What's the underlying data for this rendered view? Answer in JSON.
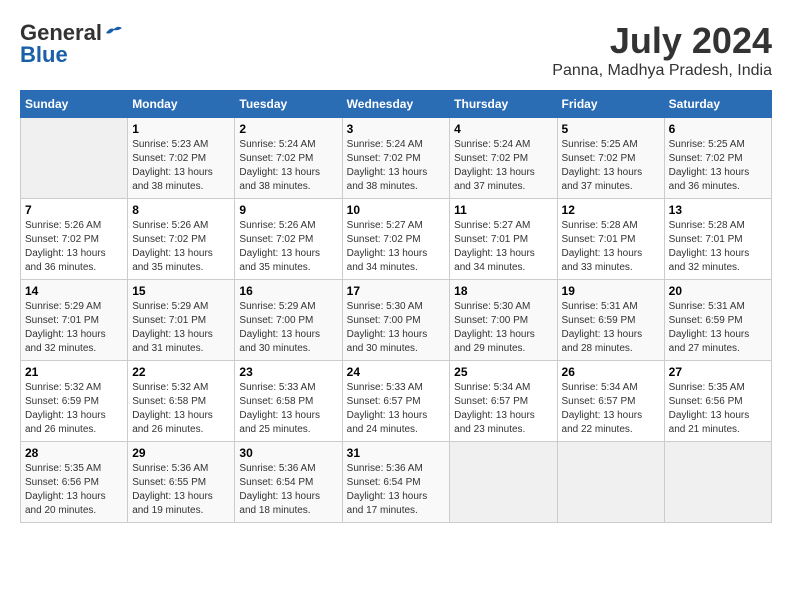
{
  "logo": {
    "general": "General",
    "blue": "Blue"
  },
  "title": "July 2024",
  "subtitle": "Panna, Madhya Pradesh, India",
  "days_of_week": [
    "Sunday",
    "Monday",
    "Tuesday",
    "Wednesday",
    "Thursday",
    "Friday",
    "Saturday"
  ],
  "weeks": [
    [
      {
        "day": "",
        "empty": true
      },
      {
        "day": "1",
        "sunrise": "Sunrise: 5:23 AM",
        "sunset": "Sunset: 7:02 PM",
        "daylight": "Daylight: 13 hours and 38 minutes."
      },
      {
        "day": "2",
        "sunrise": "Sunrise: 5:24 AM",
        "sunset": "Sunset: 7:02 PM",
        "daylight": "Daylight: 13 hours and 38 minutes."
      },
      {
        "day": "3",
        "sunrise": "Sunrise: 5:24 AM",
        "sunset": "Sunset: 7:02 PM",
        "daylight": "Daylight: 13 hours and 38 minutes."
      },
      {
        "day": "4",
        "sunrise": "Sunrise: 5:24 AM",
        "sunset": "Sunset: 7:02 PM",
        "daylight": "Daylight: 13 hours and 37 minutes."
      },
      {
        "day": "5",
        "sunrise": "Sunrise: 5:25 AM",
        "sunset": "Sunset: 7:02 PM",
        "daylight": "Daylight: 13 hours and 37 minutes."
      },
      {
        "day": "6",
        "sunrise": "Sunrise: 5:25 AM",
        "sunset": "Sunset: 7:02 PM",
        "daylight": "Daylight: 13 hours and 36 minutes."
      }
    ],
    [
      {
        "day": "7",
        "sunrise": "Sunrise: 5:26 AM",
        "sunset": "Sunset: 7:02 PM",
        "daylight": "Daylight: 13 hours and 36 minutes."
      },
      {
        "day": "8",
        "sunrise": "Sunrise: 5:26 AM",
        "sunset": "Sunset: 7:02 PM",
        "daylight": "Daylight: 13 hours and 35 minutes."
      },
      {
        "day": "9",
        "sunrise": "Sunrise: 5:26 AM",
        "sunset": "Sunset: 7:02 PM",
        "daylight": "Daylight: 13 hours and 35 minutes."
      },
      {
        "day": "10",
        "sunrise": "Sunrise: 5:27 AM",
        "sunset": "Sunset: 7:02 PM",
        "daylight": "Daylight: 13 hours and 34 minutes."
      },
      {
        "day": "11",
        "sunrise": "Sunrise: 5:27 AM",
        "sunset": "Sunset: 7:01 PM",
        "daylight": "Daylight: 13 hours and 34 minutes."
      },
      {
        "day": "12",
        "sunrise": "Sunrise: 5:28 AM",
        "sunset": "Sunset: 7:01 PM",
        "daylight": "Daylight: 13 hours and 33 minutes."
      },
      {
        "day": "13",
        "sunrise": "Sunrise: 5:28 AM",
        "sunset": "Sunset: 7:01 PM",
        "daylight": "Daylight: 13 hours and 32 minutes."
      }
    ],
    [
      {
        "day": "14",
        "sunrise": "Sunrise: 5:29 AM",
        "sunset": "Sunset: 7:01 PM",
        "daylight": "Daylight: 13 hours and 32 minutes."
      },
      {
        "day": "15",
        "sunrise": "Sunrise: 5:29 AM",
        "sunset": "Sunset: 7:01 PM",
        "daylight": "Daylight: 13 hours and 31 minutes."
      },
      {
        "day": "16",
        "sunrise": "Sunrise: 5:29 AM",
        "sunset": "Sunset: 7:00 PM",
        "daylight": "Daylight: 13 hours and 30 minutes."
      },
      {
        "day": "17",
        "sunrise": "Sunrise: 5:30 AM",
        "sunset": "Sunset: 7:00 PM",
        "daylight": "Daylight: 13 hours and 30 minutes."
      },
      {
        "day": "18",
        "sunrise": "Sunrise: 5:30 AM",
        "sunset": "Sunset: 7:00 PM",
        "daylight": "Daylight: 13 hours and 29 minutes."
      },
      {
        "day": "19",
        "sunrise": "Sunrise: 5:31 AM",
        "sunset": "Sunset: 6:59 PM",
        "daylight": "Daylight: 13 hours and 28 minutes."
      },
      {
        "day": "20",
        "sunrise": "Sunrise: 5:31 AM",
        "sunset": "Sunset: 6:59 PM",
        "daylight": "Daylight: 13 hours and 27 minutes."
      }
    ],
    [
      {
        "day": "21",
        "sunrise": "Sunrise: 5:32 AM",
        "sunset": "Sunset: 6:59 PM",
        "daylight": "Daylight: 13 hours and 26 minutes."
      },
      {
        "day": "22",
        "sunrise": "Sunrise: 5:32 AM",
        "sunset": "Sunset: 6:58 PM",
        "daylight": "Daylight: 13 hours and 26 minutes."
      },
      {
        "day": "23",
        "sunrise": "Sunrise: 5:33 AM",
        "sunset": "Sunset: 6:58 PM",
        "daylight": "Daylight: 13 hours and 25 minutes."
      },
      {
        "day": "24",
        "sunrise": "Sunrise: 5:33 AM",
        "sunset": "Sunset: 6:57 PM",
        "daylight": "Daylight: 13 hours and 24 minutes."
      },
      {
        "day": "25",
        "sunrise": "Sunrise: 5:34 AM",
        "sunset": "Sunset: 6:57 PM",
        "daylight": "Daylight: 13 hours and 23 minutes."
      },
      {
        "day": "26",
        "sunrise": "Sunrise: 5:34 AM",
        "sunset": "Sunset: 6:57 PM",
        "daylight": "Daylight: 13 hours and 22 minutes."
      },
      {
        "day": "27",
        "sunrise": "Sunrise: 5:35 AM",
        "sunset": "Sunset: 6:56 PM",
        "daylight": "Daylight: 13 hours and 21 minutes."
      }
    ],
    [
      {
        "day": "28",
        "sunrise": "Sunrise: 5:35 AM",
        "sunset": "Sunset: 6:56 PM",
        "daylight": "Daylight: 13 hours and 20 minutes."
      },
      {
        "day": "29",
        "sunrise": "Sunrise: 5:36 AM",
        "sunset": "Sunset: 6:55 PM",
        "daylight": "Daylight: 13 hours and 19 minutes."
      },
      {
        "day": "30",
        "sunrise": "Sunrise: 5:36 AM",
        "sunset": "Sunset: 6:54 PM",
        "daylight": "Daylight: 13 hours and 18 minutes."
      },
      {
        "day": "31",
        "sunrise": "Sunrise: 5:36 AM",
        "sunset": "Sunset: 6:54 PM",
        "daylight": "Daylight: 13 hours and 17 minutes."
      },
      {
        "day": "",
        "empty": true
      },
      {
        "day": "",
        "empty": true
      },
      {
        "day": "",
        "empty": true
      }
    ]
  ]
}
